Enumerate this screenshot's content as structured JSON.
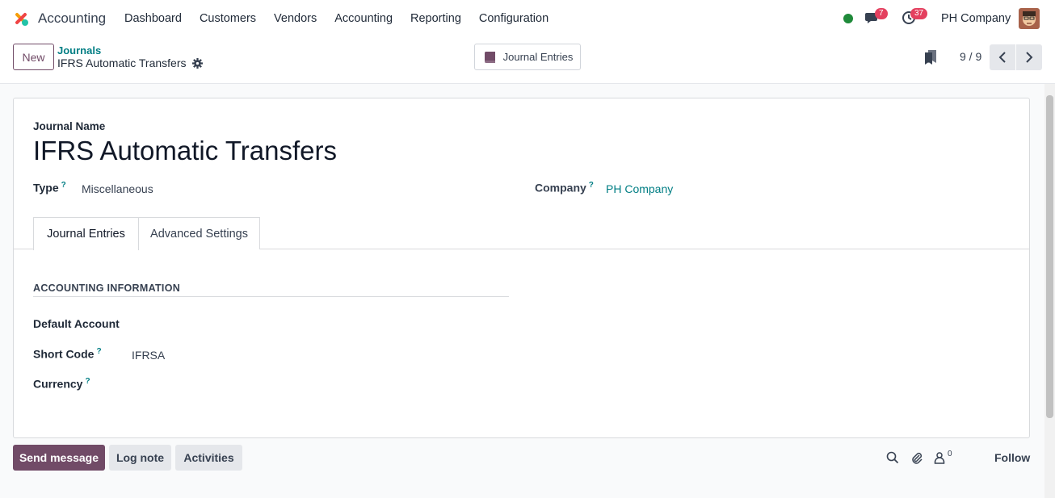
{
  "app": {
    "name": "Accounting"
  },
  "menu": [
    "Dashboard",
    "Customers",
    "Vendors",
    "Accounting",
    "Reporting",
    "Configuration"
  ],
  "systray": {
    "chat_count": "7",
    "activity_count": "37",
    "company": "PH Company"
  },
  "control": {
    "new_label": "New",
    "breadcrumb_parent": "Journals",
    "breadcrumb_current": "IFRS Automatic Transfers",
    "smart_button": "Journal Entries",
    "pager": "9 / 9"
  },
  "form": {
    "journal_name_label": "Journal Name",
    "journal_name": "IFRS Automatic Transfers",
    "type_label": "Type",
    "type_value": "Miscellaneous",
    "company_label": "Company",
    "company_value": "PH Company",
    "tabs": [
      "Journal Entries",
      "Advanced Settings"
    ],
    "section_title": "ACCOUNTING INFORMATION",
    "default_account_label": "Default Account",
    "short_code_label": "Short Code",
    "short_code_value": "IFRSA",
    "currency_label": "Currency",
    "help_mark": "?"
  },
  "chatter": {
    "send_message": "Send message",
    "log_note": "Log note",
    "activities": "Activities",
    "follower_count": "0",
    "follow": "Follow"
  },
  "colors": {
    "brand": "#714b67",
    "link": "#017e84",
    "presence": "#1f8a3a",
    "badge": "#e4405f"
  }
}
